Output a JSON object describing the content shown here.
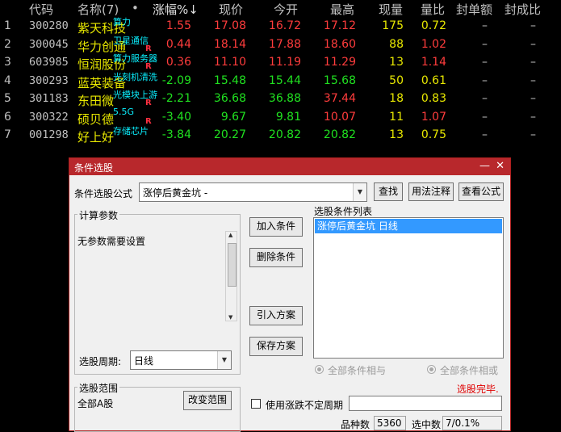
{
  "table": {
    "headers": [
      "代码",
      "名称(7)",
      "•",
      "涨幅%↓",
      "现价",
      "今开",
      "最高",
      "现量",
      "量比",
      "封单额",
      "封成比"
    ],
    "rows": [
      {
        "idx": "1",
        "code": "300280",
        "name": "紫天科技",
        "tag": "算力",
        "r": "",
        "chg": "1.55",
        "price": "17.08",
        "open": "16.72",
        "high": "17.12",
        "vol": "175",
        "ratio": "0.72",
        "seal": "–",
        "sealr": "–",
        "chgc": "red",
        "pc": "red",
        "oc": "red",
        "hc": "red",
        "rc": "yellow"
      },
      {
        "idx": "2",
        "code": "300045",
        "name": "华力创通",
        "tag": "卫星通信",
        "r": "R",
        "chg": "0.44",
        "price": "18.14",
        "open": "17.88",
        "high": "18.60",
        "vol": "88",
        "ratio": "1.02",
        "seal": "–",
        "sealr": "–",
        "chgc": "red",
        "pc": "red",
        "oc": "red",
        "hc": "red",
        "rc": "red"
      },
      {
        "idx": "3",
        "code": "603985",
        "name": "恒润股份",
        "tag": "算力服务器",
        "r": "R",
        "chg": "0.36",
        "price": "11.10",
        "open": "11.19",
        "high": "11.29",
        "vol": "13",
        "ratio": "1.14",
        "seal": "–",
        "sealr": "–",
        "chgc": "red",
        "pc": "red",
        "oc": "red",
        "hc": "red",
        "rc": "red"
      },
      {
        "idx": "4",
        "code": "300293",
        "name": "蓝英装备",
        "tag": "光刻机清洗",
        "r": "",
        "chg": "-2.09",
        "price": "15.48",
        "open": "15.44",
        "high": "15.68",
        "vol": "50",
        "ratio": "0.61",
        "seal": "–",
        "sealr": "–",
        "chgc": "green",
        "pc": "green",
        "oc": "green",
        "hc": "green",
        "rc": "yellow"
      },
      {
        "idx": "5",
        "code": "301183",
        "name": "东田微",
        "tag": "光模块上游",
        "r": "R",
        "chg": "-2.21",
        "price": "36.68",
        "open": "36.88",
        "high": "37.44",
        "vol": "18",
        "ratio": "0.83",
        "seal": "–",
        "sealr": "–",
        "chgc": "green",
        "pc": "green",
        "oc": "green",
        "hc": "red",
        "rc": "yellow"
      },
      {
        "idx": "6",
        "code": "300322",
        "name": "硕贝德",
        "tag": "5.5G",
        "r": "R",
        "chg": "-3.40",
        "price": "9.67",
        "open": "9.81",
        "high": "10.07",
        "vol": "11",
        "ratio": "1.07",
        "seal": "–",
        "sealr": "–",
        "chgc": "green",
        "pc": "green",
        "oc": "green",
        "hc": "red",
        "rc": "red"
      },
      {
        "idx": "7",
        "code": "001298",
        "name": "好上好",
        "tag": "存储芯片",
        "r": "",
        "chg": "-3.84",
        "price": "20.27",
        "open": "20.82",
        "high": "20.82",
        "vol": "13",
        "ratio": "0.75",
        "seal": "–",
        "sealr": "–",
        "chgc": "green",
        "pc": "green",
        "oc": "green",
        "hc": "green",
        "rc": "yellow"
      }
    ]
  },
  "dialog": {
    "title": "条件选股",
    "formula_label": "条件选股公式",
    "formula_value": "涨停后黄金坑  -",
    "find": "查找",
    "usage": "用法注释",
    "view_formula": "查看公式",
    "calc_params": "计算参数",
    "no_params": "无参数需要设置",
    "add_condition": "加入条件",
    "delete_condition": "删除条件",
    "import_scheme": "引入方案",
    "save_scheme": "保存方案",
    "condition_list_label": "选股条件列表",
    "condition_item": "涨停后黄金坑  日线",
    "period_label": "选股周期:",
    "period_value": "日线",
    "and_label": "全部条件相与",
    "or_label": "全部条件相或",
    "done": "选股完毕.",
    "range_label": "选股范围",
    "range_value": "全部A股",
    "change_range": "改变范围",
    "use_undetermined": "使用涨跌不定周期",
    "count_label": "品种数",
    "count_value": "5360",
    "selected_label": "选中数",
    "selected_value": "7/0.1%"
  },
  "colors": {
    "up": "#ff3c3c",
    "down": "#20e020",
    "title_bar": "#b8282c",
    "accent": "#e00000"
  }
}
